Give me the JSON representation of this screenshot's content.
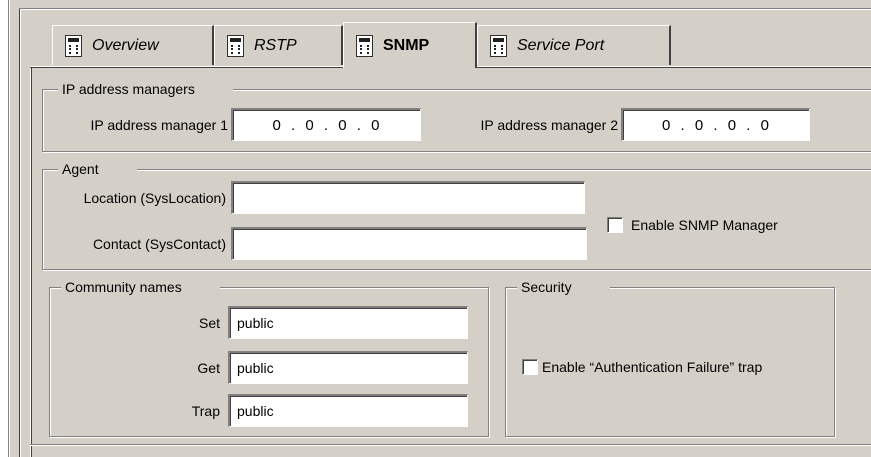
{
  "tabs": [
    {
      "label": "Overview",
      "active": false
    },
    {
      "label": "RSTP",
      "active": false
    },
    {
      "label": "SNMP",
      "active": true
    },
    {
      "label": "Service Port",
      "active": false
    }
  ],
  "ip_managers": {
    "title": "IP address managers",
    "manager1_label": "IP address manager 1",
    "manager1_value": "0 . 0 . 0 . 0",
    "manager2_label": "IP address manager 2",
    "manager2_value": "0 . 0 . 0 . 0"
  },
  "agent": {
    "title": "Agent",
    "location_label": "Location (SysLocation)",
    "location_value": "",
    "contact_label": "Contact (SysContact)",
    "contact_value": "",
    "enable_manager_label": "Enable SNMP Manager",
    "enable_manager_checked": false
  },
  "community": {
    "title": "Community names",
    "set_label": "Set",
    "set_value": "public",
    "get_label": "Get",
    "get_value": "public",
    "trap_label": "Trap",
    "trap_value": "public"
  },
  "security": {
    "title": "Security",
    "auth_trap_label": "Enable “Authentication Failure” trap",
    "auth_trap_checked": false
  }
}
